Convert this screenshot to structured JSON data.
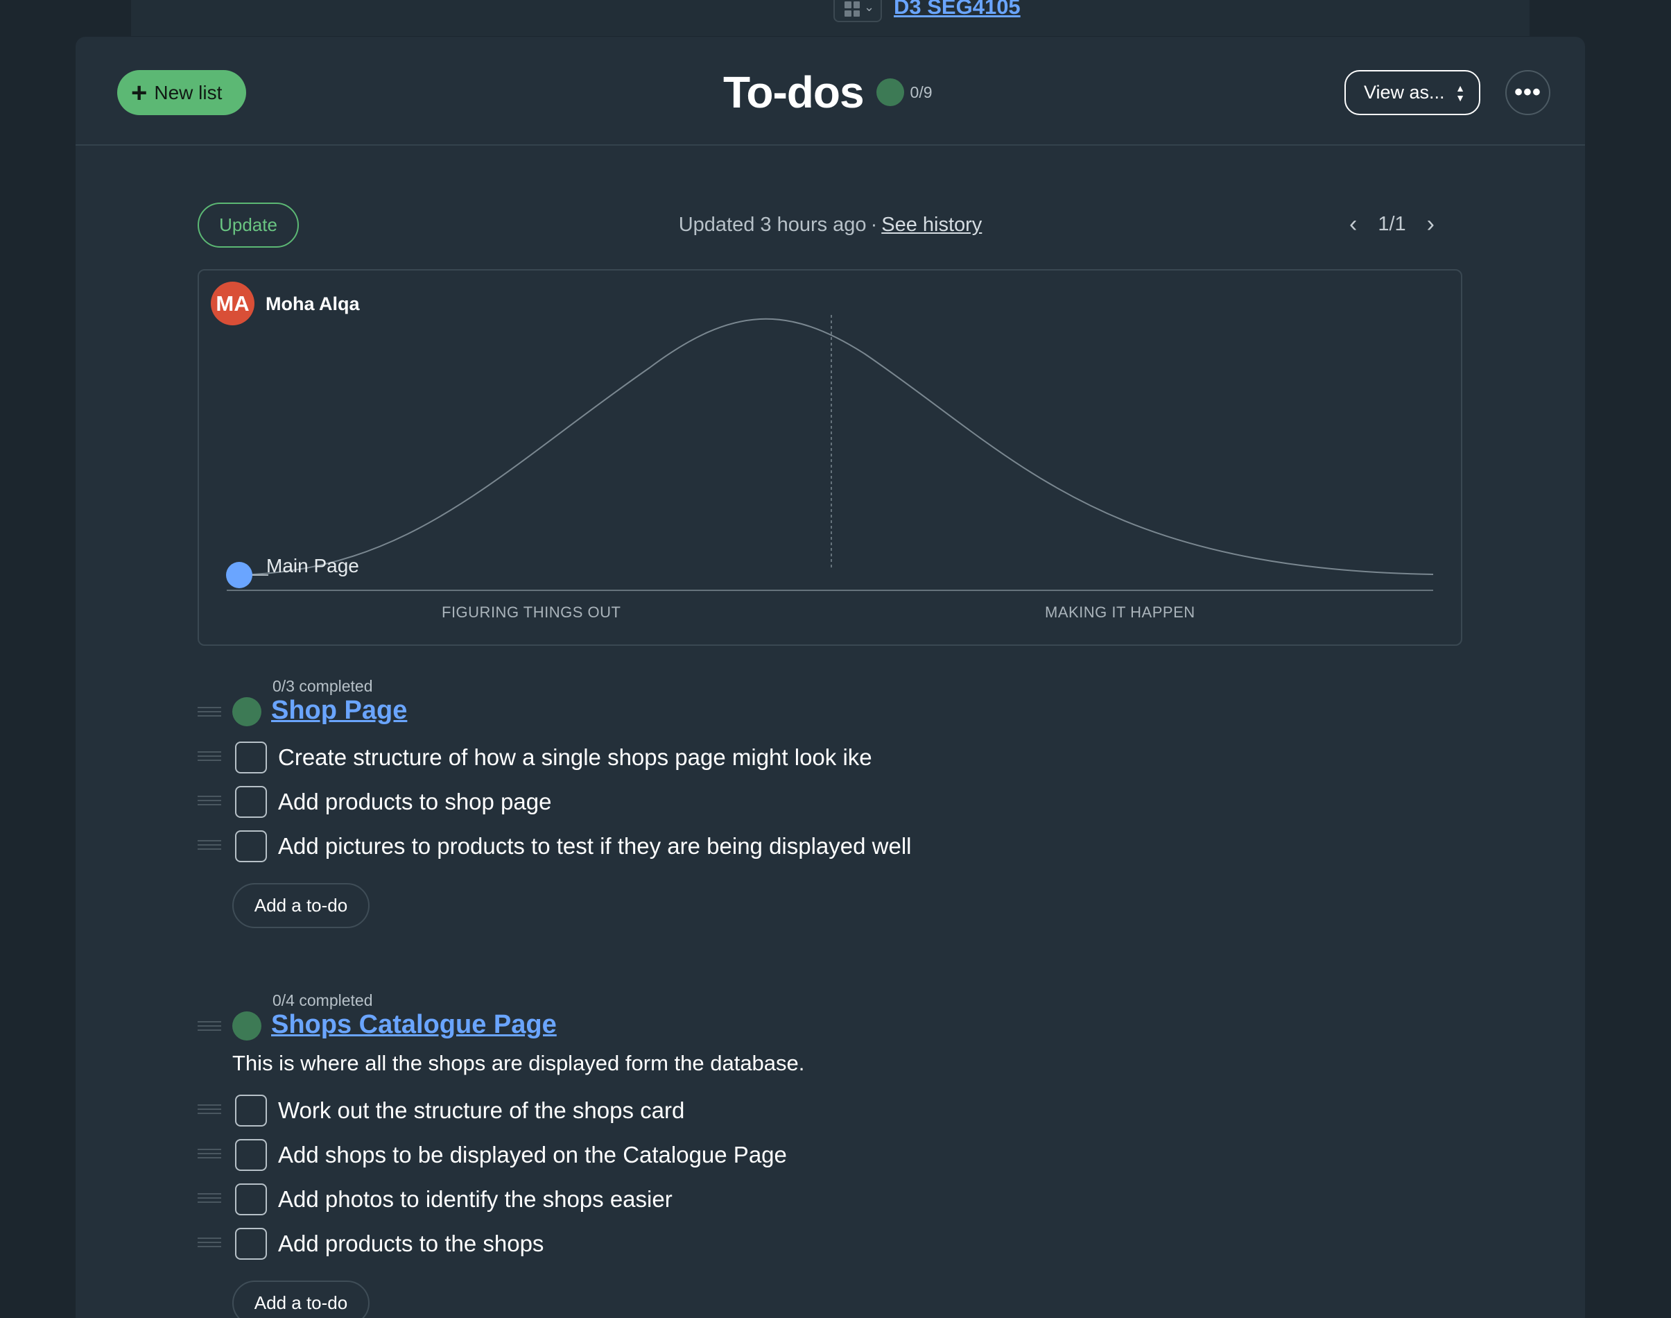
{
  "breadcrumb": {
    "project_name": "D3 SEG4105"
  },
  "header": {
    "new_list_label": "New list",
    "title": "To-dos",
    "progress": "0/9",
    "view_as_label": "View as...",
    "more_label": "•••"
  },
  "hill_section": {
    "update_label": "Update",
    "updated_text": "Updated 3 hours ago",
    "separator": "·",
    "see_history_label": "See history",
    "pager": "1/1",
    "person_initials": "MA",
    "person_name": "Moha Alqa",
    "left_phase": "FIGURING THINGS OUT",
    "right_phase": "MAKING IT HAPPEN",
    "dot_label": "Main Page",
    "colors": {
      "dot": "#6aa5ff",
      "avatar": "#d94f37",
      "curve": "#7a8790"
    }
  },
  "lists": [
    {
      "completed": "0/3 completed",
      "title": "Shop Page",
      "description": "",
      "todos": [
        "Create structure of how a single shops page might look ike",
        "Add products to shop page",
        "Add pictures to products to test if they are being displayed well"
      ],
      "add_label": "Add a to-do"
    },
    {
      "completed": "0/4 completed",
      "title": "Shops Catalogue Page",
      "description": "This is where all the shops are displayed form the database.",
      "todos": [
        "Work out the structure of the shops card",
        "Add shops to be displayed on the Catalogue Page",
        "Add photos to identify the shops easier",
        "Add products to the shops"
      ],
      "add_label": "Add a to-do"
    }
  ],
  "colors": {
    "accent_green": "#5cb874",
    "link_blue": "#6aa5ff",
    "card_bg": "#24303a"
  }
}
